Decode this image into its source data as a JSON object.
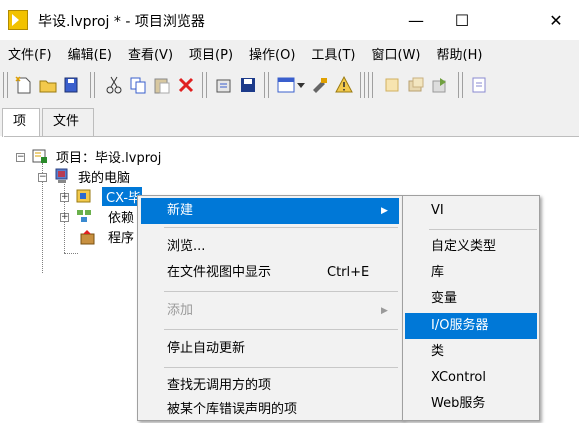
{
  "window": {
    "title": "毕设.lvproj * - 项目浏览器",
    "min_icon": "—",
    "max_icon": "☐",
    "close_icon": "✕"
  },
  "menubar": [
    "文件(F)",
    "编辑(E)",
    "查看(V)",
    "项目(P)",
    "操作(O)",
    "工具(T)",
    "窗口(W)",
    "帮助(H)"
  ],
  "toolbar": {
    "icons": [
      "new-icon",
      "open-icon",
      "save-all-icon",
      "cut-icon",
      "copy-icon",
      "paste-icon",
      "delete-icon",
      "build-icon",
      "save-icon",
      "view-options-icon",
      "dropdown-arrow-icon",
      "tool-icon",
      "warning-icon",
      "files-icon",
      "dependencies-icon",
      "deploy-icon",
      "more-icon"
    ]
  },
  "tabs": [
    "项",
    "文件"
  ],
  "tree": {
    "project": "项目：毕设.lvproj",
    "computer": "我的电脑",
    "selected": "CX-毕设",
    "dependencies": "依赖",
    "build": "程序"
  },
  "context_menu": {
    "items": [
      {
        "label": "新建",
        "highlight": true,
        "submenu": true
      },
      {
        "label": "浏览..."
      },
      {
        "label": "在文件视图中显示",
        "shortcut": "Ctrl+E"
      },
      {
        "label": "添加",
        "disabled": true,
        "submenu": true
      },
      {
        "label": "停止自动更新"
      },
      {
        "label": "查找无调用方的项"
      },
      {
        "label": "被某个库错误声明的项"
      }
    ]
  },
  "submenu": {
    "items": [
      {
        "label": "VI"
      },
      {
        "label": "自定义类型"
      },
      {
        "label": "库"
      },
      {
        "label": "变量"
      },
      {
        "label": "I/O服务器",
        "highlight": true
      },
      {
        "label": "类"
      },
      {
        "label": "XControl"
      },
      {
        "label": "Web服务"
      }
    ]
  },
  "colors": {
    "highlight": "#0078d7",
    "menu_bg": "#f2f2f2",
    "chrome_bg": "#f0f0f0"
  }
}
